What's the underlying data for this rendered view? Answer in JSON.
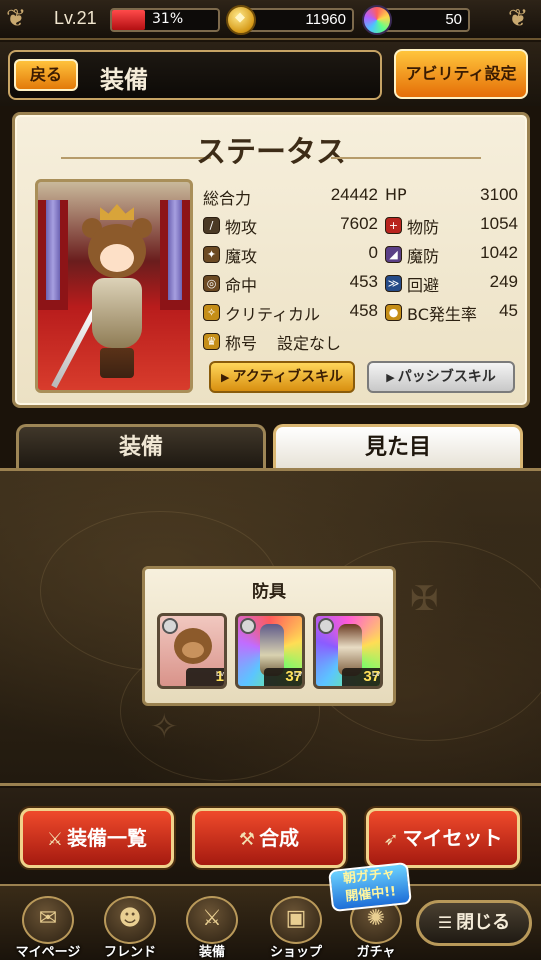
{
  "topbar": {
    "level": "Lv.21",
    "exp_percent": 31,
    "exp_label": "31%",
    "coins": "11960",
    "gems": "50"
  },
  "header": {
    "back_label": "戻る",
    "title": "装備",
    "ability_label": "アビリティ設定"
  },
  "status": {
    "title": "ステータス",
    "stats_left": [
      {
        "label": "総合力",
        "value": "24442",
        "icon": "none"
      },
      {
        "label": "物攻",
        "value": "7602",
        "icon": "sword-icon"
      },
      {
        "label": "魔攻",
        "value": "0",
        "icon": "wand-icon"
      },
      {
        "label": "命中",
        "value": "453",
        "icon": "accuracy-icon"
      },
      {
        "label": "クリティカル",
        "value": "458",
        "icon": "critical-icon"
      },
      {
        "label": "称号",
        "value": "設定なし",
        "icon": "title-icon"
      }
    ],
    "stats_right": [
      {
        "label": "HP",
        "value": "3100",
        "icon": "none"
      },
      {
        "label": "物防",
        "value": "1054",
        "icon": "shield-icon"
      },
      {
        "label": "魔防",
        "value": "1042",
        "icon": "magic-shield-icon"
      },
      {
        "label": "回避",
        "value": "249",
        "icon": "evade-icon"
      },
      {
        "label": "BC発生率",
        "value": "45",
        "icon": "bc-icon"
      }
    ],
    "active_skill_label": "アクティブスキル",
    "passive_skill_label": "パッシブスキル"
  },
  "tabs": {
    "equip_label": "装備",
    "look_label": "見た目",
    "selected": "見た目"
  },
  "armor": {
    "title": "防具",
    "slots": [
      {
        "lv_prefix": "Lv.",
        "level": "1"
      },
      {
        "lv_prefix": "Lv.",
        "level": "37"
      },
      {
        "lv_prefix": "Lv.",
        "level": "37"
      }
    ]
  },
  "actions": {
    "equip_list_label": "装備一覧",
    "synth_label": "合成",
    "myset_label": "マイセット"
  },
  "nav": {
    "mypage_label": "マイページ",
    "friend_label": "フレンド",
    "equip_label": "装備",
    "shop_label": "ショップ",
    "gacha_label": "ガチャ",
    "gacha_badge_line1": "朝ガチャ",
    "gacha_badge_line2": "開催中!!",
    "close_label": "閉じる"
  }
}
